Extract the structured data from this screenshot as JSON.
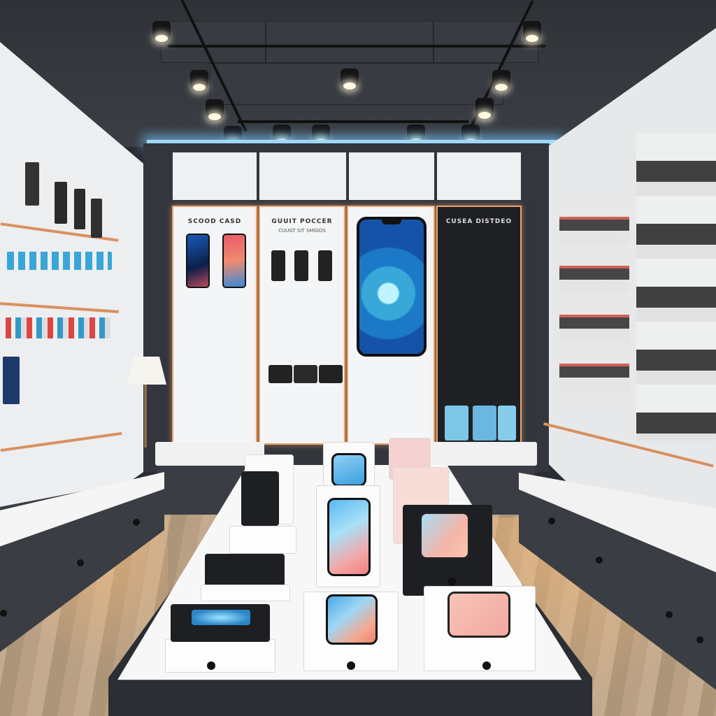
{
  "scene": {
    "type": "photo-realistic illustration",
    "colors": {
      "accent_led": "#9fd8ff",
      "trim": "#e9a26b",
      "cabinet": "#3a3d43",
      "floor": "#b9a085"
    }
  },
  "signs": {
    "board_1_title": "SCOOD CASD",
    "board_2_title": "GUUIT POCCER",
    "board_2_subtitle": "CUUGT SIT SMIGOS",
    "board_4_title": "CUSEA DISTDEO"
  }
}
